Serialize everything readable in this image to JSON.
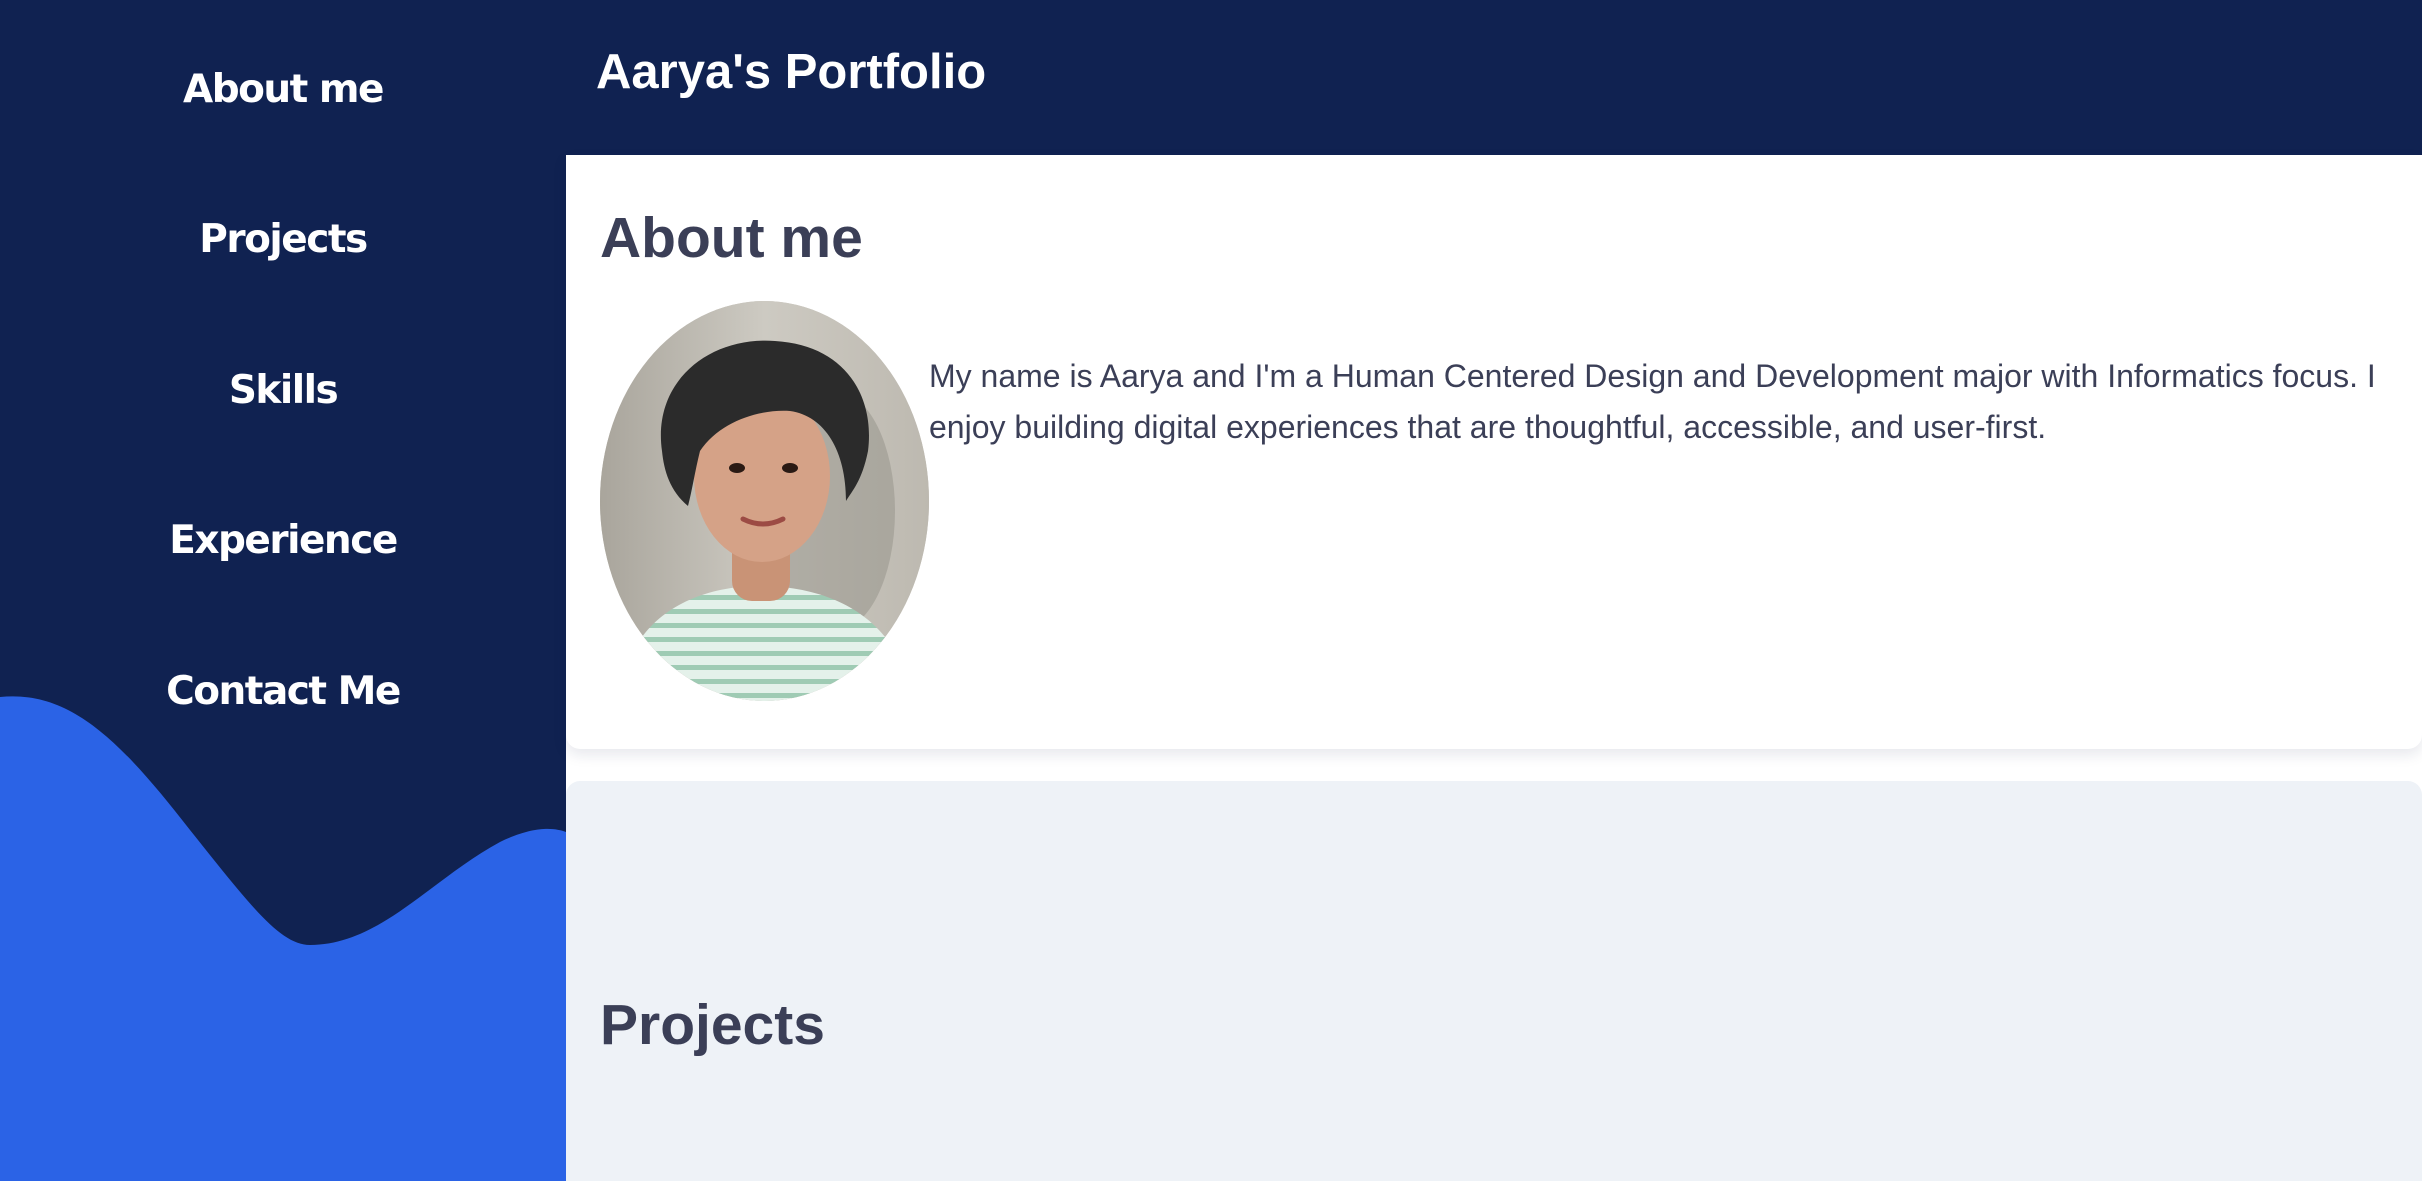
{
  "sidebar": {
    "items": [
      {
        "label": "About me"
      },
      {
        "label": "Projects"
      },
      {
        "label": "Skills"
      },
      {
        "label": "Experience"
      },
      {
        "label": "Contact Me"
      }
    ]
  },
  "header": {
    "title": "Aarya's Portfolio"
  },
  "about": {
    "heading": "About me",
    "bio": "My name is Aarya and I'm a Human Centered Design and Development major with Informatics focus. I enjoy building digital experiences that are thoughtful, accessible, and user-first."
  },
  "projects": {
    "heading": "Projects"
  },
  "colors": {
    "navy": "#102251",
    "accent_blue": "#2b63e6",
    "text": "#3b3f57",
    "section_bg": "#eef2f7"
  }
}
